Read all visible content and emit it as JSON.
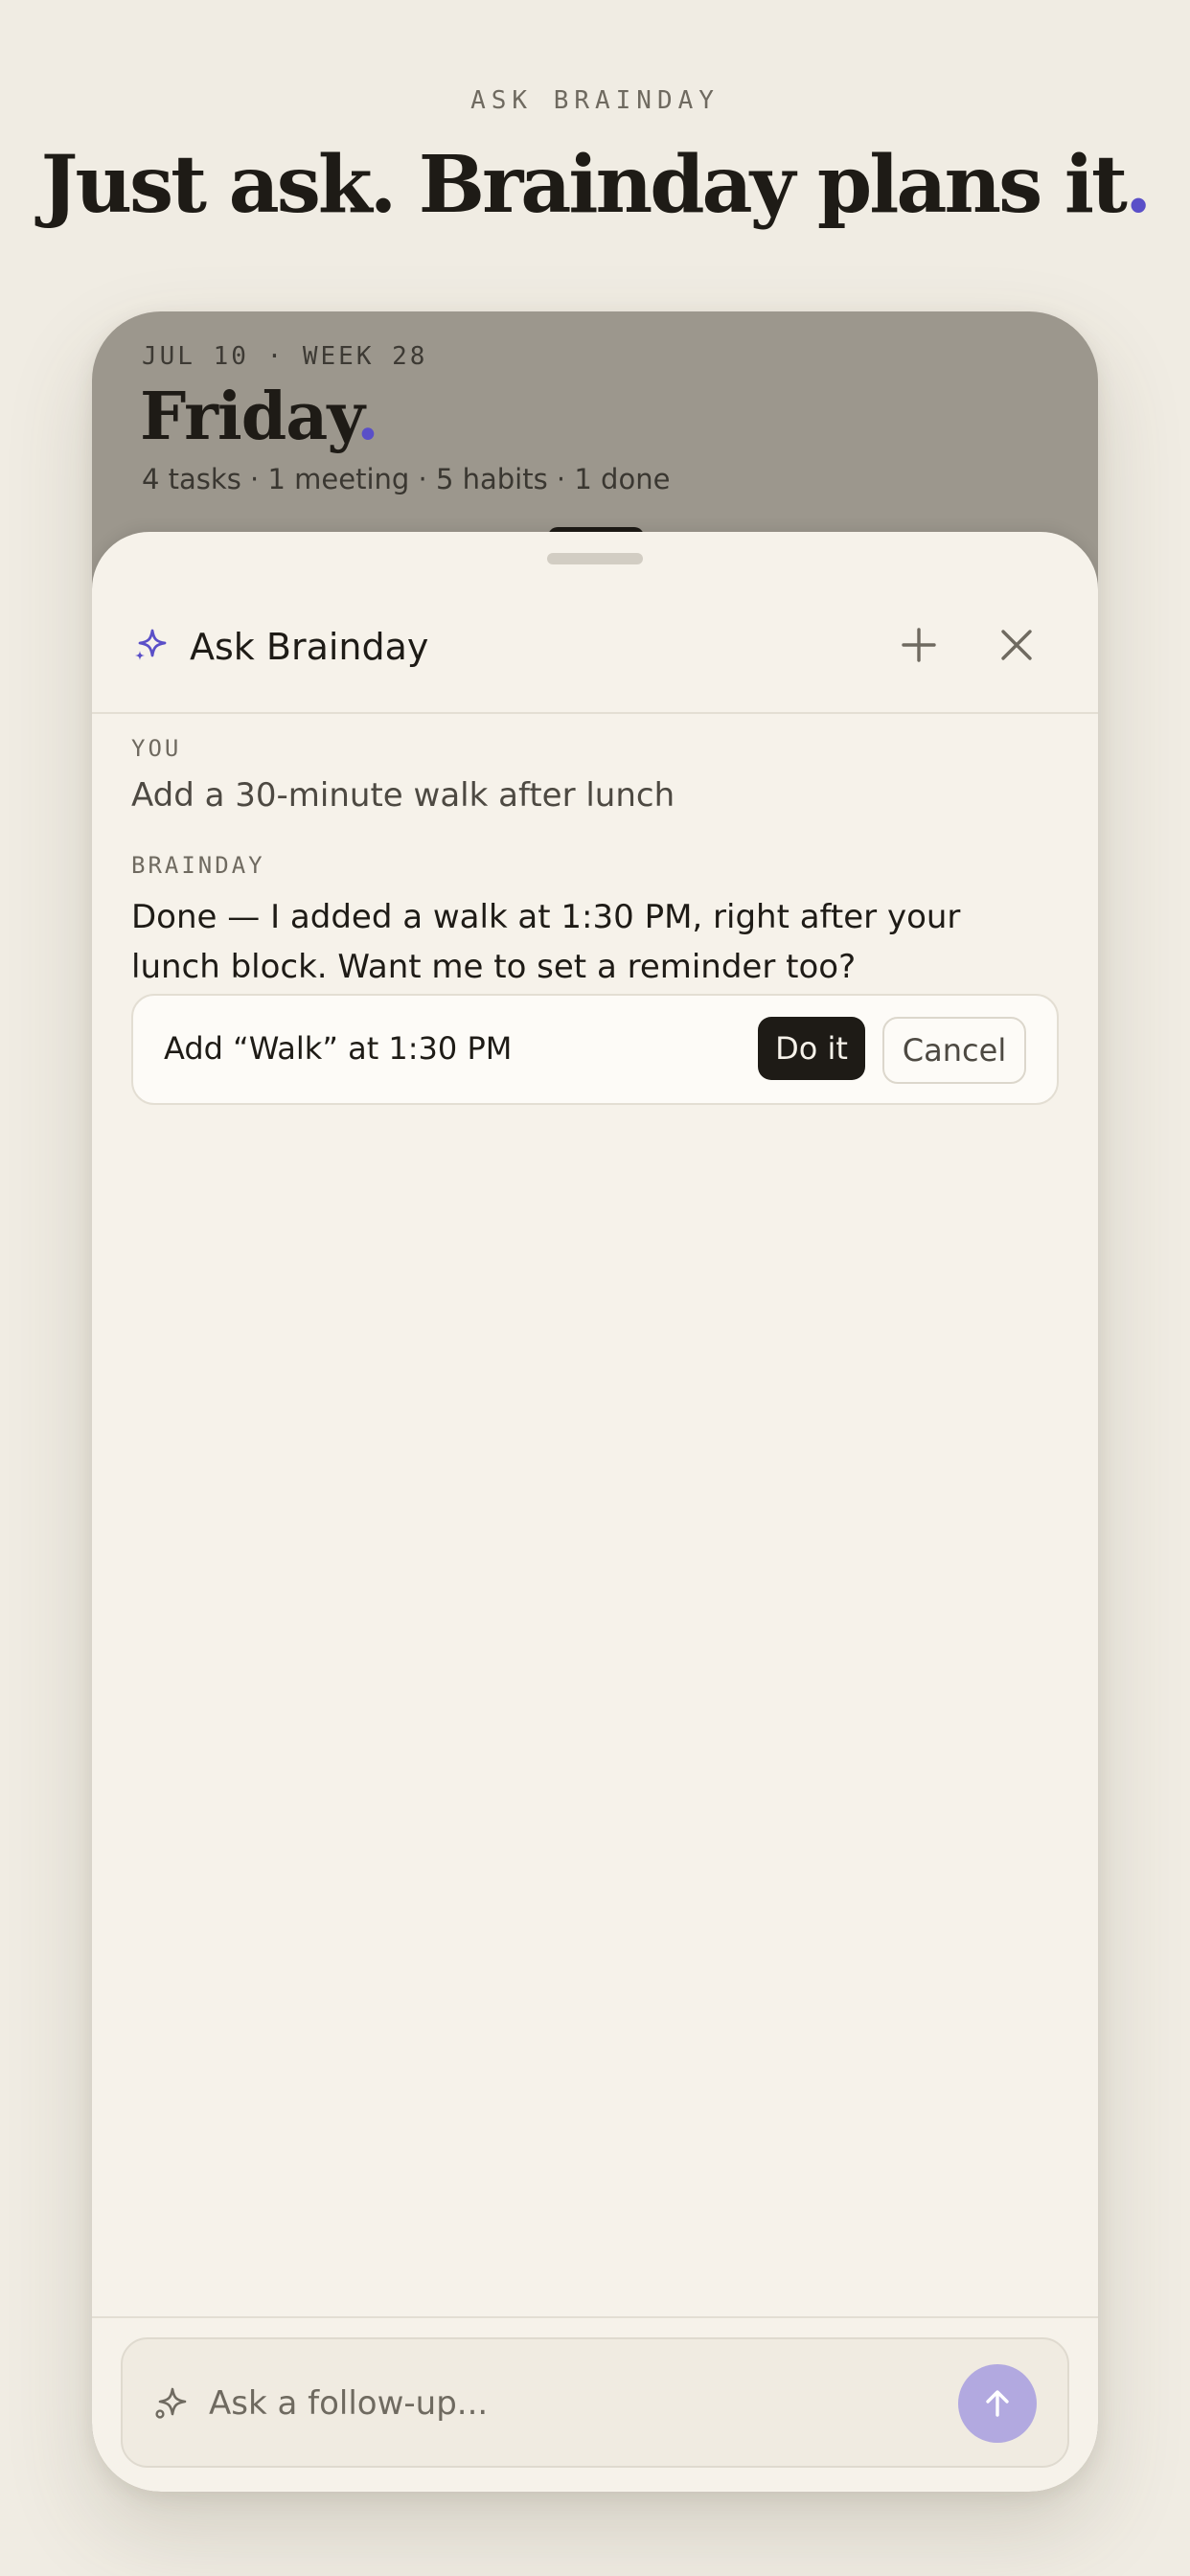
{
  "hero": {
    "eyebrow": "ASK BRAINDAY",
    "headline": "Just ask. Brainday plans it",
    "headline_dot": "."
  },
  "background_screen": {
    "date": "JUL 10 · WEEK 28",
    "day": "Friday",
    "day_dot": ".",
    "summary": "4 tasks · 1 meeting · 5 habits · 1 done"
  },
  "sheet": {
    "title": "Ask Brainday",
    "icons": {
      "title": "sparkle-icon",
      "new": "plus-icon",
      "close": "close-icon"
    }
  },
  "conversation": {
    "user_label": "YOU",
    "user_message": "Add a 30-minute walk after lunch",
    "assistant_label": "BRAINDAY",
    "assistant_message": "Done — I added a walk at 1:30 PM, right after your lunch block. Want me to set a reminder too?",
    "action": {
      "text": "Add “Walk” at 1:30 PM",
      "confirm_label": "Do it",
      "cancel_label": "Cancel"
    }
  },
  "composer": {
    "placeholder": "Ask a follow-up...",
    "icon": "sparkle-icon",
    "send_icon": "arrow-up-icon"
  },
  "colors": {
    "accent": "#5a4fc8",
    "send_button": "#b2a9e0",
    "page_background": "#f0ece3",
    "sheet_background": "#f6f2ea",
    "dark": "#1e1b16"
  }
}
